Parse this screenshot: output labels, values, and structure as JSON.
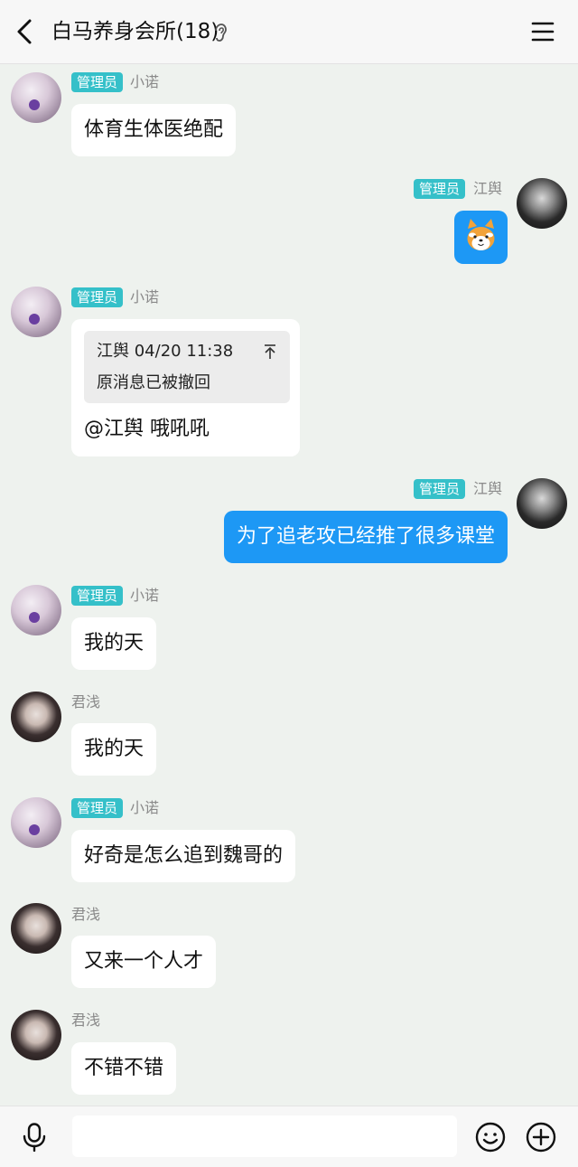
{
  "header": {
    "title": "白马养身会所(18)",
    "icons": [
      "back-icon",
      "ear-icon",
      "menu-icon"
    ]
  },
  "messages": [
    {
      "sender": "小诺",
      "badge": "管理员",
      "side": "left",
      "text": "体育生体医绝配"
    },
    {
      "sender": "江舆",
      "badge": "管理员",
      "side": "right",
      "sticker": "shiba-dog-sticker"
    },
    {
      "sender": "小诺",
      "badge": "管理员",
      "side": "left",
      "quote": {
        "author_time": "江舆 04/20 11:38",
        "body": "原消息已被撤回"
      },
      "text": "@江舆 哦吼吼"
    },
    {
      "sender": "江舆",
      "badge": "管理员",
      "side": "right",
      "text": "为了追老攻已经推了很多课堂"
    },
    {
      "sender": "小诺",
      "badge": "管理员",
      "side": "left",
      "text": "我的天"
    },
    {
      "sender": "君浅",
      "side": "left",
      "text": "我的天"
    },
    {
      "sender": "小诺",
      "badge": "管理员",
      "side": "left",
      "text": "好奇是怎么追到魏哥的"
    },
    {
      "sender": "君浅",
      "side": "left",
      "text": "又来一个人才"
    },
    {
      "sender": "君浅",
      "side": "left",
      "text": "不错不错"
    }
  ],
  "input_bar": {
    "value": "",
    "icons": [
      "mic-icon",
      "emoji-icon",
      "plus-icon"
    ]
  },
  "colors": {
    "self_bubble": "#1d98f5",
    "badge": "#35c0c9",
    "background": "#eef2ee"
  }
}
